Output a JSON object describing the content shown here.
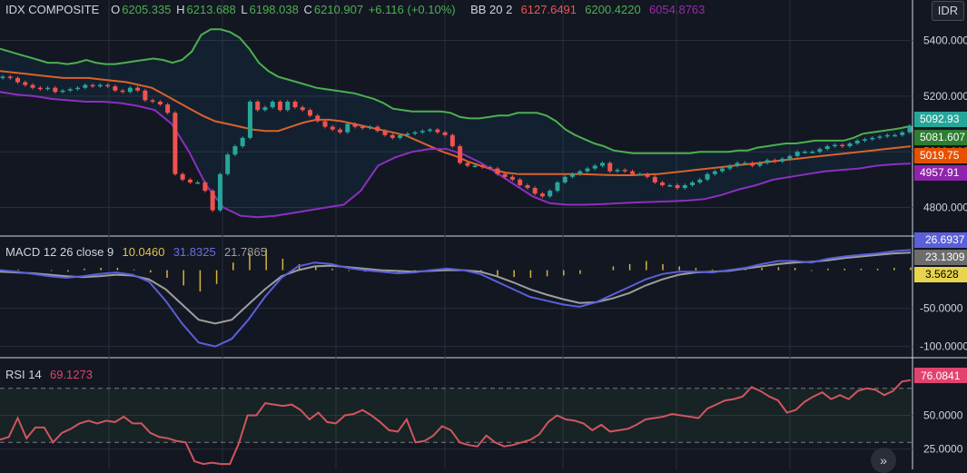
{
  "symbol": "IDX COMPOSITE",
  "ohlc": {
    "o_label": "O",
    "o": "6205.335",
    "h_label": "H",
    "h": "6213.688",
    "l_label": "L",
    "l": "6198.038",
    "c_label": "C",
    "c": "6210.907",
    "change": "+6.116 (+0.10%)"
  },
  "bb": {
    "label": "BB 20 2",
    "basis": "6127.6491",
    "upper": "6200.4220",
    "lower": "6054.8763"
  },
  "macd": {
    "label": "MACD 12 26 close 9",
    "histogram": "10.0460",
    "macd": "31.8325",
    "signal": "21.7865"
  },
  "rsi": {
    "label": "RSI 14",
    "value": "69.1273"
  },
  "currency": "IDR",
  "nav_icon": "»",
  "colors": {
    "up": "#26a69a",
    "down": "#ef5350",
    "bb_upper": "#4caf50",
    "bb_basis": "#d9632a",
    "bb_lower": "#8c2fc0",
    "macd_line": "#5b5fd9",
    "signal_line": "#9e9e9e",
    "macd_hist": "#d4b437",
    "rsi_line": "#d05560",
    "ohlc_text": "#4caf50"
  },
  "chart_data": [
    {
      "type": "candlestick",
      "name": "price",
      "y_ticks": [
        5400,
        5200,
        5000,
        4800
      ],
      "y_tick_labels": [
        "5400.000",
        "5200.000",
        "5000.000",
        "4800.000"
      ],
      "ylim": [
        4730,
        5480
      ],
      "price_badges": [
        "5092.93",
        "5081.607",
        "5019.75",
        "4957.91"
      ],
      "close": [
        5270,
        5265,
        5250,
        5240,
        5230,
        5225,
        5230,
        5215,
        5220,
        5225,
        5230,
        5240,
        5235,
        5240,
        5235,
        5220,
        5215,
        5230,
        5220,
        5185,
        5180,
        5170,
        5140,
        4920,
        4900,
        4890,
        4890,
        4860,
        4790,
        4920,
        4990,
        5020,
        5050,
        5180,
        5150,
        5160,
        5180,
        5150,
        5180,
        5160,
        5150,
        5130,
        5110,
        5090,
        5080,
        5070,
        5100,
        5090,
        5085,
        5090,
        5075,
        5060,
        5050,
        5060,
        5065,
        5070,
        5075,
        5080,
        5070,
        5060,
        5020,
        4960,
        4950,
        4950,
        4945,
        4940,
        4920,
        4910,
        4900,
        4880,
        4870,
        4850,
        4840,
        4860,
        4890,
        4910,
        4920,
        4930,
        4940,
        4950,
        4960,
        4930,
        4935,
        4930,
        4920,
        4920,
        4910,
        4890,
        4880,
        4880,
        4870,
        4880,
        4890,
        4900,
        4920,
        4930,
        4940,
        4950,
        4960,
        4960,
        4950,
        4960,
        4970,
        4965,
        4975,
        4985,
        5000,
        5000,
        5000,
        5010,
        5020,
        5025,
        5020,
        5030,
        5040,
        5045,
        5050,
        5055,
        5060,
        5060,
        5070,
        5092.93
      ]
    },
    {
      "type": "band",
      "name": "BB 20 2",
      "upper": [
        5370,
        5360,
        5350,
        5340,
        5330,
        5320,
        5320,
        5315,
        5320,
        5330,
        5320,
        5315,
        5315,
        5320,
        5325,
        5330,
        5335,
        5330,
        5320,
        5330,
        5360,
        5420,
        5440,
        5440,
        5430,
        5410,
        5370,
        5320,
        5290,
        5270,
        5260,
        5250,
        5240,
        5230,
        5225,
        5220,
        5215,
        5210,
        5200,
        5190,
        5175,
        5155,
        5150,
        5145,
        5145,
        5145,
        5145,
        5140,
        5125,
        5120,
        5120,
        5125,
        5130,
        5130,
        5140,
        5140,
        5140,
        5130,
        5110,
        5080,
        5060,
        5045,
        5030,
        5020,
        5005,
        5000,
        4995,
        4995,
        4995,
        4995,
        4995,
        4995,
        4995,
        5000,
        5000,
        5000,
        5000,
        5005,
        5005,
        5015,
        5020,
        5025,
        5030,
        5030,
        5035,
        5040,
        5040,
        5040,
        5040,
        5050,
        5065,
        5070,
        5075,
        5080,
        5085,
        5092.93
      ],
      "basis": [
        5290,
        5285,
        5280,
        5275,
        5270,
        5265,
        5265,
        5265,
        5260,
        5255,
        5250,
        5240,
        5230,
        5205,
        5180,
        5155,
        5130,
        5110,
        5100,
        5090,
        5080,
        5075,
        5075,
        5090,
        5105,
        5115,
        5115,
        5110,
        5100,
        5090,
        5080,
        5070,
        5060,
        5040,
        5020,
        5000,
        4985,
        4965,
        4950,
        4935,
        4925,
        4920,
        4920,
        4920,
        4920,
        4920,
        4920,
        4918,
        4917,
        4916,
        4916,
        4918,
        4920,
        4925,
        4930,
        4935,
        4940,
        4945,
        4950,
        4955,
        4960,
        4965,
        4970,
        4975,
        4980,
        4985,
        4990,
        4995,
        5000,
        5005,
        5010,
        5015,
        5019.75
      ],
      "lower": [
        5215,
        5205,
        5200,
        5190,
        5185,
        5180,
        5180,
        5175,
        5165,
        5150,
        5100,
        5000,
        4880,
        4800,
        4770,
        4765,
        4770,
        4780,
        4790,
        4800,
        4810,
        4860,
        4950,
        4980,
        5000,
        5010,
        5010,
        4990,
        4960,
        4920,
        4880,
        4840,
        4815,
        4810,
        4810,
        4812,
        4815,
        4818,
        4820,
        4822,
        4825,
        4830,
        4845,
        4865,
        4880,
        4900,
        4910,
        4920,
        4930,
        4935,
        4940,
        4950,
        4955,
        4957.91
      ]
    },
    {
      "type": "line",
      "name": "MACD 12 26 close 9",
      "y_ticks": [
        -50,
        -100
      ],
      "y_tick_labels": [
        "-50.0000",
        "-100.0000"
      ],
      "ylim": [
        -110,
        40
      ],
      "value_badges": [
        "26.6937",
        "23.1309",
        "3.5628"
      ],
      "macd": [
        0,
        -2,
        -5,
        -8,
        -10,
        -8,
        -5,
        -3,
        -6,
        -15,
        -40,
        -70,
        -95,
        -100,
        -90,
        -65,
        -35,
        -10,
        5,
        10,
        8,
        3,
        0,
        -2,
        -4,
        -3,
        0,
        2,
        0,
        -5,
        -15,
        -25,
        -35,
        -40,
        -45,
        -48,
        -42,
        -32,
        -22,
        -12,
        -5,
        -2,
        -2,
        -3,
        0,
        3,
        8,
        12,
        12,
        10,
        15,
        18,
        20,
        22,
        25,
        26.69
      ],
      "signal": [
        -2,
        -3,
        -4,
        -6,
        -8,
        -9,
        -8,
        -6,
        -7,
        -12,
        -25,
        -45,
        -65,
        -70,
        -65,
        -45,
        -25,
        -8,
        0,
        5,
        6,
        4,
        2,
        0,
        -1,
        -2,
        -1,
        0,
        0,
        -2,
        -8,
        -16,
        -25,
        -32,
        -38,
        -43,
        -42,
        -37,
        -30,
        -20,
        -12,
        -6,
        -3,
        -2,
        -1,
        2,
        5,
        8,
        10,
        11,
        13,
        16,
        18,
        20,
        22,
        23.13
      ],
      "histogram": [
        1,
        1,
        0,
        -1,
        -2,
        2,
        3,
        3,
        1,
        -3,
        -10,
        -20,
        -28,
        -18,
        10,
        22,
        28,
        15,
        8,
        5,
        2,
        -1,
        -2,
        -2,
        -3,
        -1,
        1,
        2,
        -1,
        -3,
        -7,
        -9,
        -10,
        -8,
        -7,
        -5,
        0,
        5,
        8,
        12,
        8,
        5,
        3,
        1,
        1,
        1,
        3,
        4,
        3,
        -1,
        2,
        2,
        2,
        2,
        3,
        3.56
      ]
    },
    {
      "type": "line",
      "name": "RSI 14",
      "y_ticks": [
        50,
        25
      ],
      "y_tick_labels": [
        "50.0000",
        "25.0000"
      ],
      "bands": [
        70,
        30
      ],
      "ylim": [
        10,
        90
      ],
      "value_badges": [
        "76.0841"
      ],
      "values": [
        32,
        34,
        48,
        33,
        41,
        41,
        30,
        37,
        40,
        44,
        46,
        44,
        46,
        45,
        49,
        44,
        44,
        37,
        34,
        33,
        31,
        30,
        16,
        14,
        15,
        14,
        14,
        29,
        50,
        50,
        59,
        58,
        57,
        58,
        54,
        47,
        52,
        45,
        44,
        50,
        51,
        54,
        50,
        45,
        39,
        38,
        47,
        30,
        31,
        35,
        42,
        39,
        30,
        28,
        27,
        35,
        30,
        27,
        28,
        30,
        32,
        36,
        45,
        50,
        47,
        46,
        44,
        39,
        43,
        38,
        39,
        40,
        43,
        47,
        48,
        49,
        51,
        50,
        49,
        48,
        55,
        58,
        61,
        62,
        64,
        71,
        68,
        64,
        61,
        52,
        54,
        60,
        64,
        67,
        62,
        65,
        62,
        68,
        70,
        69,
        65,
        68,
        75,
        76.08
      ]
    }
  ]
}
